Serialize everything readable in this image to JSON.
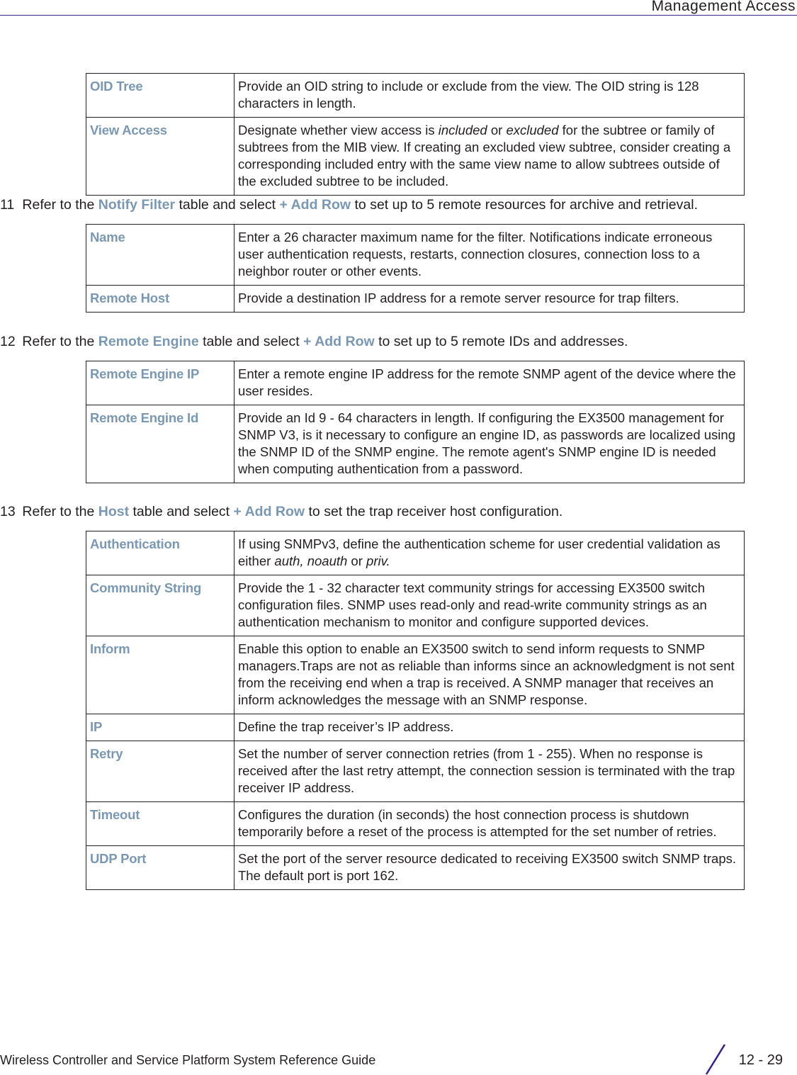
{
  "header": {
    "title": "Management Access"
  },
  "table_view": {
    "rows": [
      {
        "term": "OID Tree",
        "desc": "Provide an OID string to include or exclude from the view. The OID string is 128 characters in length."
      },
      {
        "term": "View Access",
        "desc_parts": [
          "Designate whether view access is ",
          "included",
          " or ",
          "excluded",
          " for the subtree or family of subtrees from the MIB view. If creating an excluded view subtree, consider creating a corresponding included entry with the same view name to allow subtrees outside of the excluded subtree to be included."
        ]
      }
    ]
  },
  "step11": {
    "number": "11",
    "text_1": "Refer to the ",
    "table_name": "Notify Filter",
    "text_2": " table and select ",
    "action": "+ Add Row",
    "text_3": " to set up to 5 remote resources for archive and retrieval."
  },
  "table_notify": {
    "rows": [
      {
        "term": "Name",
        "desc": "Enter a 26 character maximum name for the filter. Notifications indicate erroneous user authentication requests, restarts, connection closures, connection loss to a neighbor router or other events."
      },
      {
        "term": "Remote Host",
        "desc": "Provide a destination IP address for a remote server resource for trap filters."
      }
    ]
  },
  "step12": {
    "number": "12",
    "text_1": "Refer to the ",
    "table_name": "Remote Engine",
    "text_2": " table and select ",
    "action": "+ Add Row",
    "text_3": " to set up to 5 remote IDs and addresses."
  },
  "table_engine": {
    "rows": [
      {
        "term": "Remote Engine IP",
        "desc": "Enter a remote engine IP address for the remote SNMP agent of the device where the user resides."
      },
      {
        "term": "Remote Engine Id",
        "desc": "Provide an Id 9 - 64 characters in length. If configuring the EX3500 management for SNMP V3, is it necessary to configure an engine ID, as passwords are localized using the SNMP ID of the SNMP engine. The remote agent's SNMP engine ID is needed when computing authentication from a password."
      }
    ]
  },
  "step13": {
    "number": "13",
    "text_1": "Refer to the ",
    "table_name": "Host",
    "text_2": " table and select ",
    "action": "+ Add Row",
    "text_3": " to set the trap receiver host configuration."
  },
  "table_host": {
    "rows": [
      {
        "term": "Authentication",
        "desc_parts": [
          "If using SNMPv3, define the authentication scheme for user credential validation as either ",
          "auth, noauth",
          " or ",
          "priv.",
          ""
        ]
      },
      {
        "term": "Community String",
        "desc": "Provide the 1 - 32 character text community strings for accessing EX3500 switch configuration files. SNMP uses read-only and read-write community strings as an authentication mechanism to monitor and configure supported devices."
      },
      {
        "term": "Inform",
        "desc": "Enable this option to enable an EX3500 switch to send inform requests to SNMP managers.Traps are not as reliable than informs since an acknowledgment is not sent from the receiving end when a trap is received. A SNMP manager that receives an inform acknowledges the message with an SNMP response."
      },
      {
        "term": "IP",
        "desc": "Define the trap receiver’s IP address."
      },
      {
        "term": "Retry",
        "desc": "Set the number of server connection retries (from 1 - 255). When no response is received after the last retry attempt, the connection session is terminated with the trap receiver IP address."
      },
      {
        "term": "Timeout",
        "desc": "Configures the duration (in seconds) the host connection process is shutdown temporarily before a reset of the process is attempted for the set number of retries."
      },
      {
        "term": "UDP Port",
        "desc": "Set the port of the server resource dedicated to receiving EX3500 switch SNMP traps. The default port is port 162."
      }
    ]
  },
  "footer": {
    "guide_title": "Wireless Controller and Service Platform System Reference Guide",
    "page_number": "12 - 29"
  },
  "colors": {
    "term_accent": "#7b98b3",
    "rule_purple": "#3a1f8c",
    "text": "#231f20"
  }
}
